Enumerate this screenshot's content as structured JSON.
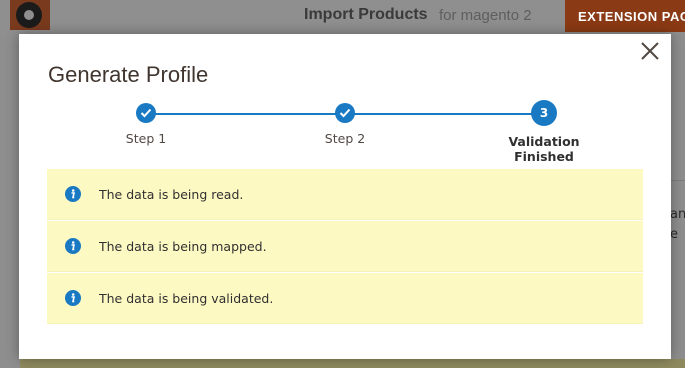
{
  "background": {
    "header_title": "Import Products",
    "header_subtitle": "for magento 2",
    "extension_button_label": "EXTENSION PAC",
    "card_text_line1": "an",
    "card_text_line2": "e"
  },
  "modal": {
    "title": "Generate Profile",
    "close_icon": "close-icon",
    "steps": [
      {
        "label": "Step 1",
        "state": "completed",
        "icon": "checkmark-icon"
      },
      {
        "label": "Step 2",
        "state": "completed",
        "icon": "checkmark-icon"
      },
      {
        "label": "Validation Finished",
        "state": "active",
        "number": "3"
      }
    ],
    "messages": [
      {
        "icon": "info-icon",
        "text": "The data is being read."
      },
      {
        "icon": "info-icon",
        "text": "The data is being mapped."
      },
      {
        "icon": "info-icon",
        "text": "The data is being validated."
      }
    ]
  },
  "colors": {
    "accent": "#1979c3",
    "message_bg": "#fdf9c3",
    "extension_button": "#eb5202"
  }
}
